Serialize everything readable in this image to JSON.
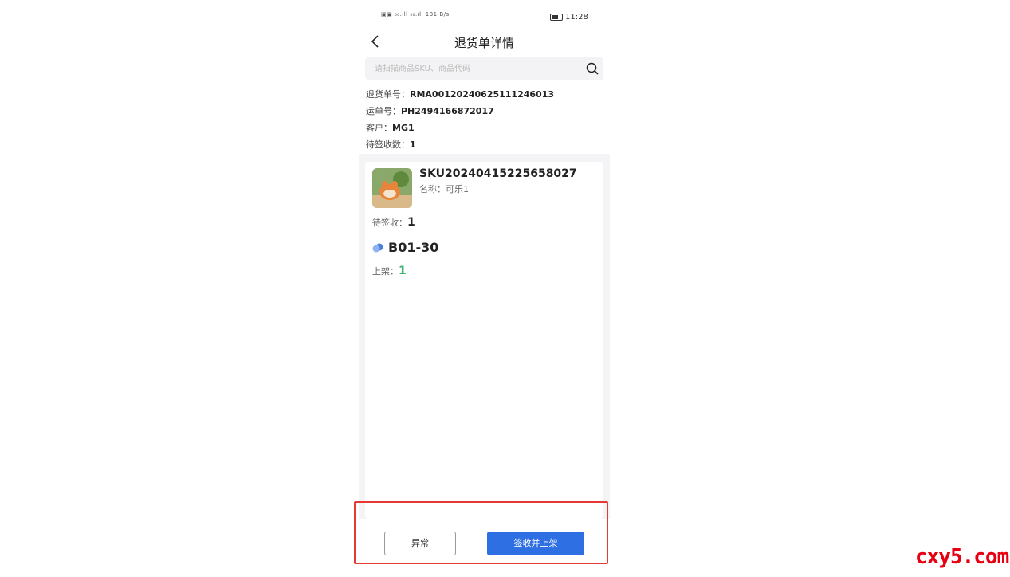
{
  "status_bar": {
    "signal_text": "▣▣ ₅₆.ıll ₅₆.ıll",
    "speed": "131 B/s",
    "time": "11:28"
  },
  "navbar": {
    "title": "退货单详情"
  },
  "search": {
    "placeholder": "请扫描商品SKU、商品代码"
  },
  "info": {
    "rma_label": "退货单号：",
    "rma_value": "RMA00120240625111246013",
    "waybill_label": "运单号：",
    "waybill_value": "PH2494166872017",
    "customer_label": "客户：",
    "customer_value": "MG1",
    "pending_label": "待签收数：",
    "pending_value": "1"
  },
  "item": {
    "sku": "SKU20240415225658027",
    "name": "名称：可乐1",
    "pending_label": "待签收：",
    "pending_value": "1",
    "location": "B01-30",
    "shelf_label": "上架：",
    "shelf_value": "1"
  },
  "actions": {
    "abnormal": "异常",
    "confirm": "签收并上架"
  },
  "watermark": "cxy5.com",
  "colors": {
    "primary": "#2f6fe4",
    "success": "#3cb371",
    "highlight": "#e53935",
    "watermark": "#e60012"
  }
}
